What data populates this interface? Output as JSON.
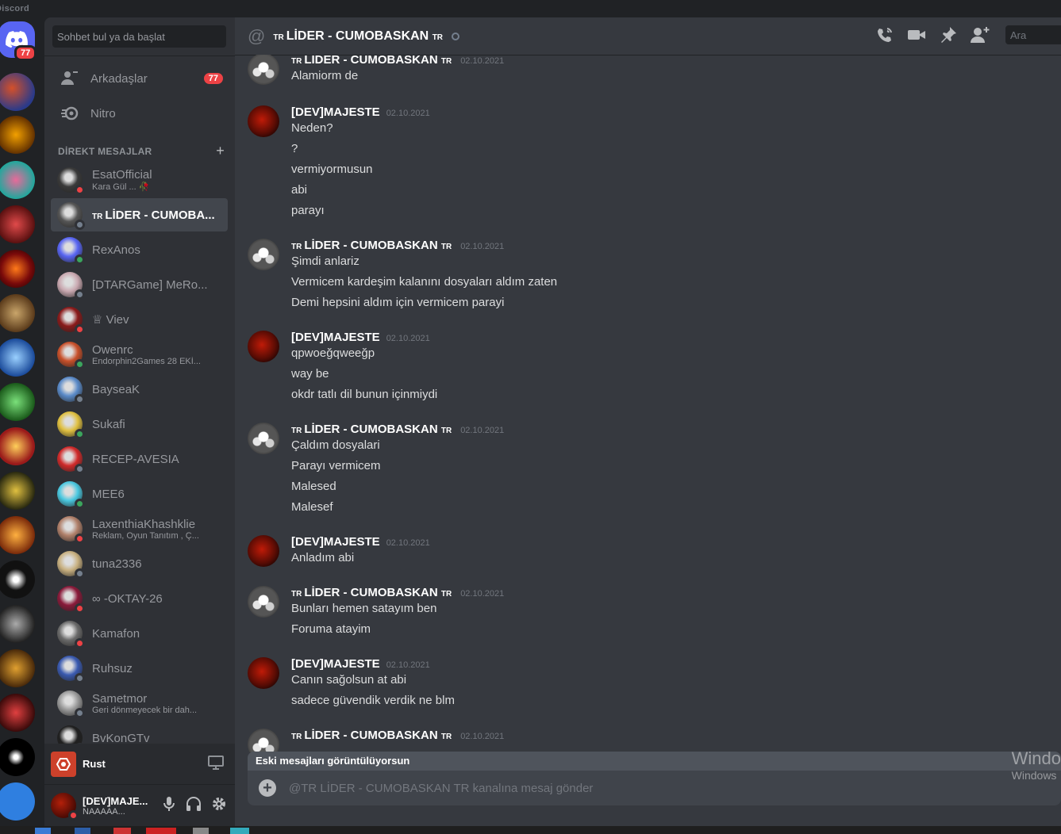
{
  "titlebar": {
    "brand": "Discord"
  },
  "rail": {
    "home_badge": "77"
  },
  "sidebar": {
    "search_placeholder": "Sohbet bul ya da başlat",
    "friends_label": "Arkadaşlar",
    "friends_badge": "77",
    "nitro_label": "Nitro",
    "dm_header": "DİREKT MESAJLAR",
    "dms": [
      {
        "name": "EsatOfficial",
        "sub": "Kara Gül ... 🥀",
        "status": "dnd"
      },
      {
        "name": "LİDER - CUMOBA...",
        "prefix": "TR",
        "sub": "",
        "status": "offline"
      },
      {
        "name": "RexAnos",
        "sub": "",
        "status": "online"
      },
      {
        "name": "[DTARGame] MeRo...",
        "sub": "",
        "status": "offline"
      },
      {
        "name": "♕ Viev",
        "sub": "",
        "status": "dnd"
      },
      {
        "name": "Owenrc",
        "sub": "Endorphin2Games 28 EKİ...",
        "status": "online"
      },
      {
        "name": "BayseaK",
        "sub": "",
        "status": "offline"
      },
      {
        "name": "Sukafi",
        "sub": "",
        "status": "online"
      },
      {
        "name": "RECEP-AVESIA",
        "sub": "",
        "status": "offline"
      },
      {
        "name": "MEE6",
        "sub": "",
        "status": "online"
      },
      {
        "name": "LaxenthiaKhashklie",
        "sub": "Reklam, Oyun Tanıtım , Ç...",
        "status": "dnd"
      },
      {
        "name": "tuna2336",
        "sub": "",
        "status": "offline"
      },
      {
        "name": "∞ -OKTAY-26",
        "sub": "",
        "status": "dnd"
      },
      {
        "name": "Kamafon",
        "sub": "",
        "status": "dnd"
      },
      {
        "name": "Ruhsuz",
        "sub": "",
        "status": "offline"
      },
      {
        "name": "Sametmor",
        "sub": "Geri dönmeyecek bir dah...",
        "status": "offline"
      },
      {
        "name": "BvKonGTv",
        "sub": "",
        "status": "offline"
      }
    ],
    "activity_game": "Rust",
    "user_name": "[DEV]MAJE...",
    "user_status": "NAAAAA..."
  },
  "chat": {
    "channel_prefix": "TR",
    "channel_name": "LİDER - CUMOBASKAN",
    "channel_suffix": "TR",
    "search_placeholder": "Ara",
    "messages": [
      {
        "author_prefix": "TR",
        "author": "LİDER - CUMOBASKAN",
        "author_suffix": "TR",
        "ts": "02.10.2021",
        "lines": [
          "Alamiorm de"
        ]
      },
      {
        "author": "[DEV]MAJESTE",
        "ts": "02.10.2021",
        "lines": [
          "Neden?",
          "?",
          "vermiyormusun",
          "abi",
          "parayı"
        ]
      },
      {
        "author_prefix": "TR",
        "author": "LİDER - CUMOBASKAN",
        "author_suffix": "TR",
        "ts": "02.10.2021",
        "lines": [
          "Şimdi anlariz",
          "Vermicem kardeşim kalanını dosyaları aldım zaten",
          "Demi hepsini aldım için vermicem parayi"
        ]
      },
      {
        "author": "[DEV]MAJESTE",
        "ts": "02.10.2021",
        "lines": [
          "qpwoeğqweeğp",
          "way be",
          "okdr tatlı dil bunun içinmiydi"
        ]
      },
      {
        "author_prefix": "TR",
        "author": "LİDER - CUMOBASKAN",
        "author_suffix": "TR",
        "ts": "02.10.2021",
        "lines": [
          "Çaldım dosyalari",
          "Parayı vermicem",
          "Malesed",
          "Malesef"
        ]
      },
      {
        "author": "[DEV]MAJESTE",
        "ts": "02.10.2021",
        "lines": [
          "Anladım abi"
        ]
      },
      {
        "author_prefix": "TR",
        "author": "LİDER - CUMOBASKAN",
        "author_suffix": "TR",
        "ts": "02.10.2021",
        "lines": [
          "Bunları hemen satayım ben",
          "Foruma atayim"
        ]
      },
      {
        "author": "[DEV]MAJESTE",
        "ts": "02.10.2021",
        "lines": [
          "Canın sağolsun at abi",
          "sadece güvendik verdik ne blm"
        ]
      },
      {
        "author_prefix": "TR",
        "author": "LİDER - CUMOBASKAN",
        "author_suffix": "TR",
        "ts": "02.10.2021",
        "lines": []
      }
    ],
    "old_banner": "Eski mesajları görüntülüyorsun",
    "composer_placeholder": "@TR LİDER - CUMOBASKAN TR kanalına mesaj gönder",
    "watermark_1": "Windo",
    "watermark_2": "Windows"
  },
  "colors": {
    "accent": "#5865f2",
    "online": "#3ba55d",
    "dnd": "#ed4245",
    "offline": "#747f8d"
  }
}
